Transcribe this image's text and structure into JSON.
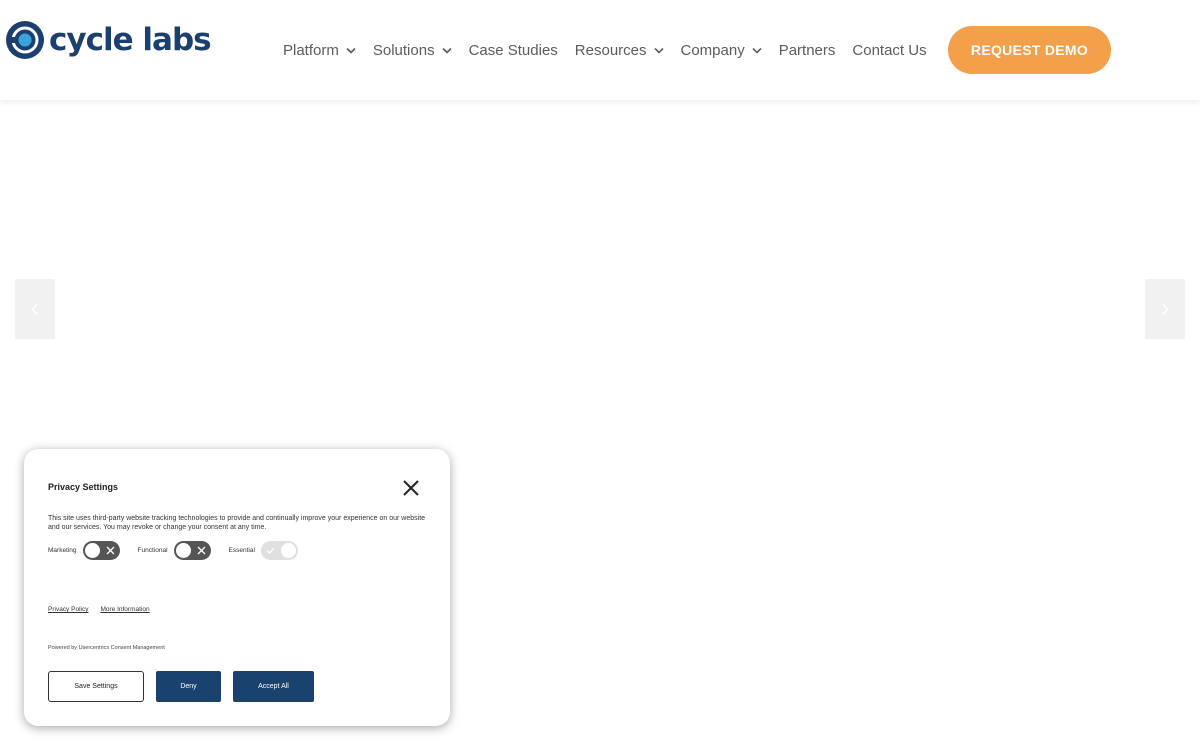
{
  "brand": {
    "name": "cycle labs",
    "logo_icon": "ring-logo-icon",
    "color_primary": "#1b3f6e",
    "color_accent": "#f4a04a"
  },
  "nav": {
    "items": [
      {
        "label": "Platform",
        "has_dropdown": true
      },
      {
        "label": "Solutions",
        "has_dropdown": true
      },
      {
        "label": "Case Studies",
        "has_dropdown": false
      },
      {
        "label": "Resources",
        "has_dropdown": true
      },
      {
        "label": "Company",
        "has_dropdown": true
      },
      {
        "label": "Partners",
        "has_dropdown": false
      },
      {
        "label": "Contact Us",
        "has_dropdown": false
      }
    ],
    "cta_label": "REQUEST DEMO"
  },
  "carousel": {
    "prev_icon": "chevron-left-icon",
    "next_icon": "chevron-right-icon"
  },
  "privacy": {
    "title": "Privacy Settings",
    "description": "This site uses third-party website tracking technologies to provide and continually improve your experience on our website and our services. You may revoke or change your consent at any time.",
    "toggles": [
      {
        "label": "Marketing",
        "enabled": false
      },
      {
        "label": "Functional",
        "enabled": false
      },
      {
        "label": "Essential",
        "enabled": true,
        "locked": true
      }
    ],
    "links": [
      "Privacy Policy",
      "More Information"
    ],
    "powered_by": "Powered by Usercentrics Consent Management",
    "buttons": {
      "save": "Save Settings",
      "deny": "Deny",
      "accept": "Accept All"
    }
  }
}
